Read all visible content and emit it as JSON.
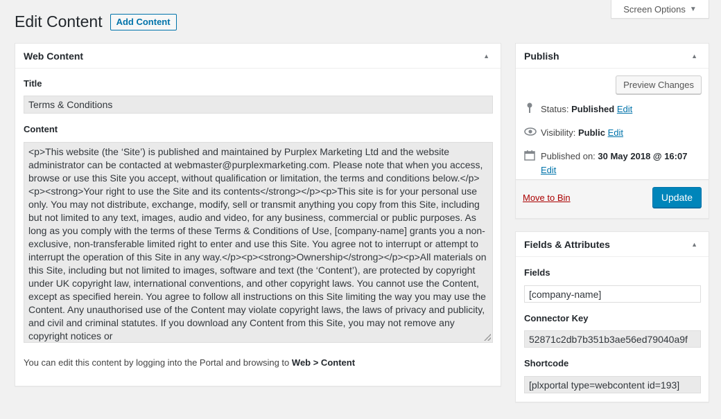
{
  "screen_options": {
    "label": "Screen Options",
    "arrow_icon": "triangle-down-icon"
  },
  "header": {
    "title": "Edit Content",
    "add_button": "Add Content"
  },
  "main": {
    "box_title": "Web Content",
    "title_label": "Title",
    "title_value": "Terms & Conditions",
    "content_label": "Content",
    "content_value": "<p>This website (the ‘Site’) is published and maintained by Purplex Marketing Ltd and the website administrator can be contacted at webmaster@purplexmarketing.com. Please note that when you access, browse or use this Site you accept, without qualification or limitation, the terms and conditions below.</p><p><strong>Your right to use the Site and its contents</strong></p><p>This site is for your personal use only. You may not distribute, exchange, modify, sell or transmit anything you copy from this Site, including but not limited to any text, images, audio and video, for any business, commercial or public purposes. As long as you comply with the terms of these Terms & Conditions of Use, [company-name] grants you a non-exclusive, non-transferable limited right to enter and use this Site. You agree not to interrupt or attempt to interrupt the operation of this Site in any way.</p><p><strong>Ownership</strong></p><p>All materials on this Site, including but not limited to images, software and text (the ‘Content’), are protected by copyright under UK copyright law, international conventions, and other copyright laws. You cannot use the Content, except as specified herein. You agree to follow all instructions on this Site limiting the way you may use the Content. Any unauthorised use of the Content may violate copyright laws, the laws of privacy and publicity, and civil and criminal statutes. If you download any Content from this Site, you may not remove any copyright notices or",
    "hint_prefix": "You can edit this content by logging into the Portal and browsing to",
    "hint_path": "Web > Content"
  },
  "publish": {
    "box_title": "Publish",
    "preview_button": "Preview Changes",
    "status_label": "Status:",
    "status_value": "Published",
    "visibility_label": "Visibility:",
    "visibility_value": "Public",
    "published_label": "Published on:",
    "published_value": "30 May 2018 @ 16:07",
    "edit_link": "Edit",
    "bin_link": "Move to Bin",
    "update_button": "Update"
  },
  "fields": {
    "box_title": "Fields & Attributes",
    "fields_label": "Fields",
    "fields_value": "[company-name]",
    "connector_label": "Connector Key",
    "connector_value": "52871c2db7b351b3ae56ed79040a9f",
    "shortcode_label": "Shortcode",
    "shortcode_value": "[plxportal type=webcontent id=193]"
  },
  "colors": {
    "accent": "#0073aa",
    "primary_button": "#0085ba",
    "danger_link": "#a00000"
  }
}
